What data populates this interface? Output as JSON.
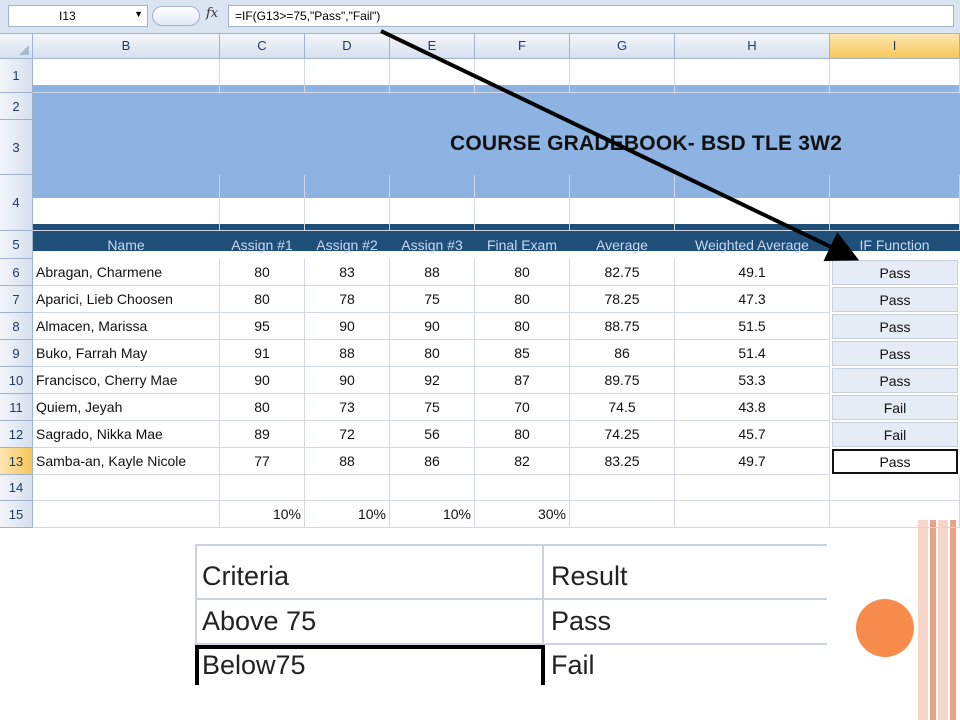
{
  "formula_bar": {
    "cell_ref": "I13",
    "fx_label": "fx",
    "formula": "=IF(G13>=75,\"Pass\",\"Fail\")"
  },
  "columns": [
    "B",
    "C",
    "D",
    "E",
    "F",
    "G",
    "H",
    "I"
  ],
  "rows": [
    "1",
    "2",
    "3",
    "4",
    "5",
    "6",
    "7",
    "8",
    "9",
    "10",
    "11",
    "12",
    "13",
    "14",
    "15"
  ],
  "title": "COURSE GRADEBOOK- BSD TLE 3W2",
  "table": {
    "headers": [
      "Name",
      "Assign #1",
      "Assign #2",
      "Assign #3",
      "Final Exam",
      "Average",
      "Weighted Average",
      "IF Function"
    ],
    "students": [
      {
        "name": "Abragan, Charmene",
        "a1": "80",
        "a2": "83",
        "a3": "88",
        "final": "80",
        "avg": "82.75",
        "wavg": "49.1",
        "result": "Pass"
      },
      {
        "name": "Aparici, Lieb Choosen",
        "a1": "80",
        "a2": "78",
        "a3": "75",
        "final": "80",
        "avg": "78.25",
        "wavg": "47.3",
        "result": "Pass"
      },
      {
        "name": "Almacen, Marissa",
        "a1": "95",
        "a2": "90",
        "a3": "90",
        "final": "80",
        "avg": "88.75",
        "wavg": "51.5",
        "result": "Pass"
      },
      {
        "name": "Buko, Farrah May",
        "a1": "91",
        "a2": "88",
        "a3": "80",
        "final": "85",
        "avg": "86",
        "wavg": "51.4",
        "result": "Pass"
      },
      {
        "name": "Francisco, Cherry Mae",
        "a1": "90",
        "a2": "90",
        "a3": "92",
        "final": "87",
        "avg": "89.75",
        "wavg": "53.3",
        "result": "Pass"
      },
      {
        "name": "Quiem, Jeyah",
        "a1": "80",
        "a2": "73",
        "a3": "75",
        "final": "70",
        "avg": "74.5",
        "wavg": "43.8",
        "result": "Fail"
      },
      {
        "name": "Sagrado, Nikka Mae",
        "a1": "89",
        "a2": "72",
        "a3": "56",
        "final": "80",
        "avg": "74.25",
        "wavg": "45.7",
        "result": "Fail"
      },
      {
        "name": "Samba-an, Kayle Nicole",
        "a1": "77",
        "a2": "88",
        "a3": "86",
        "final": "82",
        "avg": "83.25",
        "wavg": "49.7",
        "result": "Pass"
      }
    ],
    "weights": [
      "10%",
      "10%",
      "10%",
      "30%"
    ]
  },
  "criteria": {
    "header_left": "Criteria",
    "header_right": "Result",
    "row1_left": "Above 75",
    "row1_right": "Pass",
    "row2_left": "Below75",
    "row2_right": "Fail"
  },
  "colors": {
    "title_band": "#8db3e2",
    "header_band": "#1f4e79",
    "accent_dot": "#f68b4c",
    "arrow": "#000000"
  }
}
